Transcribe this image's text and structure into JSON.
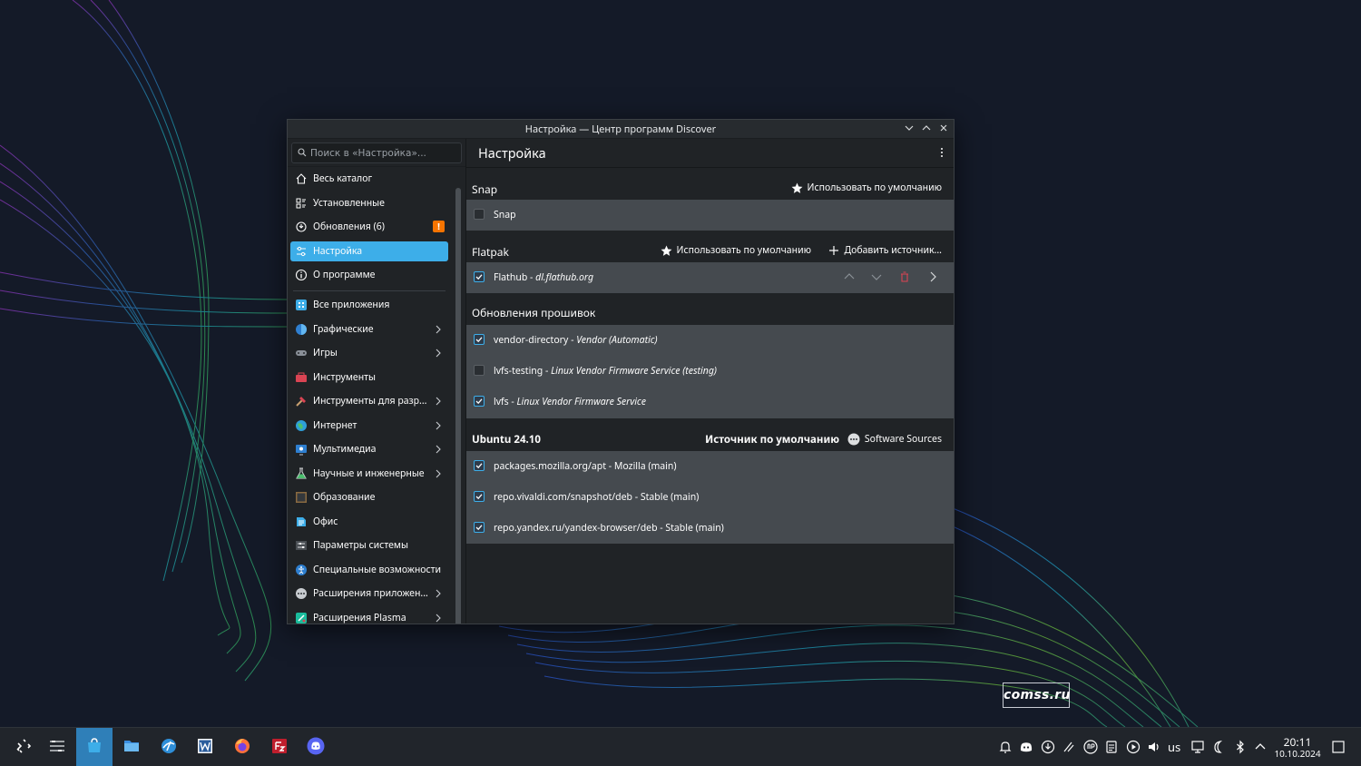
{
  "window": {
    "title": "Настройка — Центр программ Discover",
    "controls": [
      "minimize",
      "maximize",
      "close"
    ]
  },
  "search": {
    "placeholder": "Поиск в «Настройка»..."
  },
  "page_title": "Настройка",
  "sidebar": {
    "items": [
      {
        "label": "Весь каталог",
        "icon": "home-icon"
      },
      {
        "label": "Установленные",
        "icon": "installed-icon"
      },
      {
        "label": "Обновления (6)",
        "icon": "updates-icon",
        "badge": "!"
      },
      {
        "label": "Настройка",
        "icon": "settings-icon",
        "active": true
      },
      {
        "label": "О программе",
        "icon": "info-icon"
      }
    ],
    "categories": [
      {
        "label": "Все приложения",
        "icon": "all-apps-icon",
        "submenu": false
      },
      {
        "label": "Графические",
        "icon": "graphics-icon",
        "submenu": true
      },
      {
        "label": "Игры",
        "icon": "games-icon",
        "submenu": true
      },
      {
        "label": "Инструменты",
        "icon": "tools-icon",
        "submenu": false
      },
      {
        "label": "Инструменты для разр...",
        "icon": "dev-tools-icon",
        "submenu": true
      },
      {
        "label": "Интернет",
        "icon": "internet-icon",
        "submenu": true
      },
      {
        "label": "Мультимедиа",
        "icon": "multimedia-icon",
        "submenu": true
      },
      {
        "label": "Научные и инженерные",
        "icon": "science-icon",
        "submenu": true
      },
      {
        "label": "Образование",
        "icon": "education-icon",
        "submenu": false
      },
      {
        "label": "Офис",
        "icon": "office-icon",
        "submenu": false
      },
      {
        "label": "Параметры системы",
        "icon": "system-settings-icon",
        "submenu": false
      },
      {
        "label": "Специальные возможности",
        "icon": "accessibility-icon",
        "submenu": false
      },
      {
        "label": "Расширения приложен...",
        "icon": "app-addons-icon",
        "submenu": true
      },
      {
        "label": "Расширения Plasma",
        "icon": "plasma-addons-icon",
        "submenu": true
      }
    ]
  },
  "sections": {
    "snap": {
      "name": "Snap",
      "default_action": "Использовать по умолчанию",
      "rows": [
        {
          "name": "Snap",
          "detail": "",
          "checked": false
        }
      ]
    },
    "flatpak": {
      "name": "Flatpak",
      "default_action": "Использовать по умолчанию",
      "add_action": "Добавить источник...",
      "rows": [
        {
          "name": "Flathub - ",
          "detail": "dl.flathub.org",
          "checked": true
        }
      ]
    },
    "firmware": {
      "name": "Обновления прошивок",
      "rows": [
        {
          "name": "vendor-directory - ",
          "detail": "Vendor (Automatic)",
          "checked": true
        },
        {
          "name": "lvfs-testing - ",
          "detail": "Linux Vendor Firmware Service (testing)",
          "checked": false
        },
        {
          "name": "lvfs - ",
          "detail": "Linux Vendor Firmware Service",
          "checked": true
        }
      ]
    },
    "ubuntu": {
      "name": "Ubuntu 24.10",
      "default_label": "Источник по умолчанию",
      "sources_action": "Software Sources",
      "rows": [
        {
          "name": "packages.mozilla.org/apt - Mozilla (main)",
          "checked": true
        },
        {
          "name": "repo.vivaldi.com/snapshot/deb - Stable (main)",
          "checked": true
        },
        {
          "name": "repo.yandex.ru/yandex-browser/deb - Stable (main)",
          "checked": true
        }
      ]
    }
  },
  "taskbar": {
    "apps": [
      "launcher-icon",
      "overview-icon",
      "discover-icon",
      "file-manager-icon",
      "browser-icon",
      "office-writer-icon",
      "firefox-icon",
      "filezilla-icon",
      "discord-icon"
    ],
    "keyboard_layout": "us",
    "time": "20:11",
    "date": "10.10.2024"
  },
  "watermark": "comss.ru",
  "colors": {
    "accent": "#3daee9",
    "badge": "#f67400",
    "panel": "#454a4f",
    "window": "#202326"
  }
}
